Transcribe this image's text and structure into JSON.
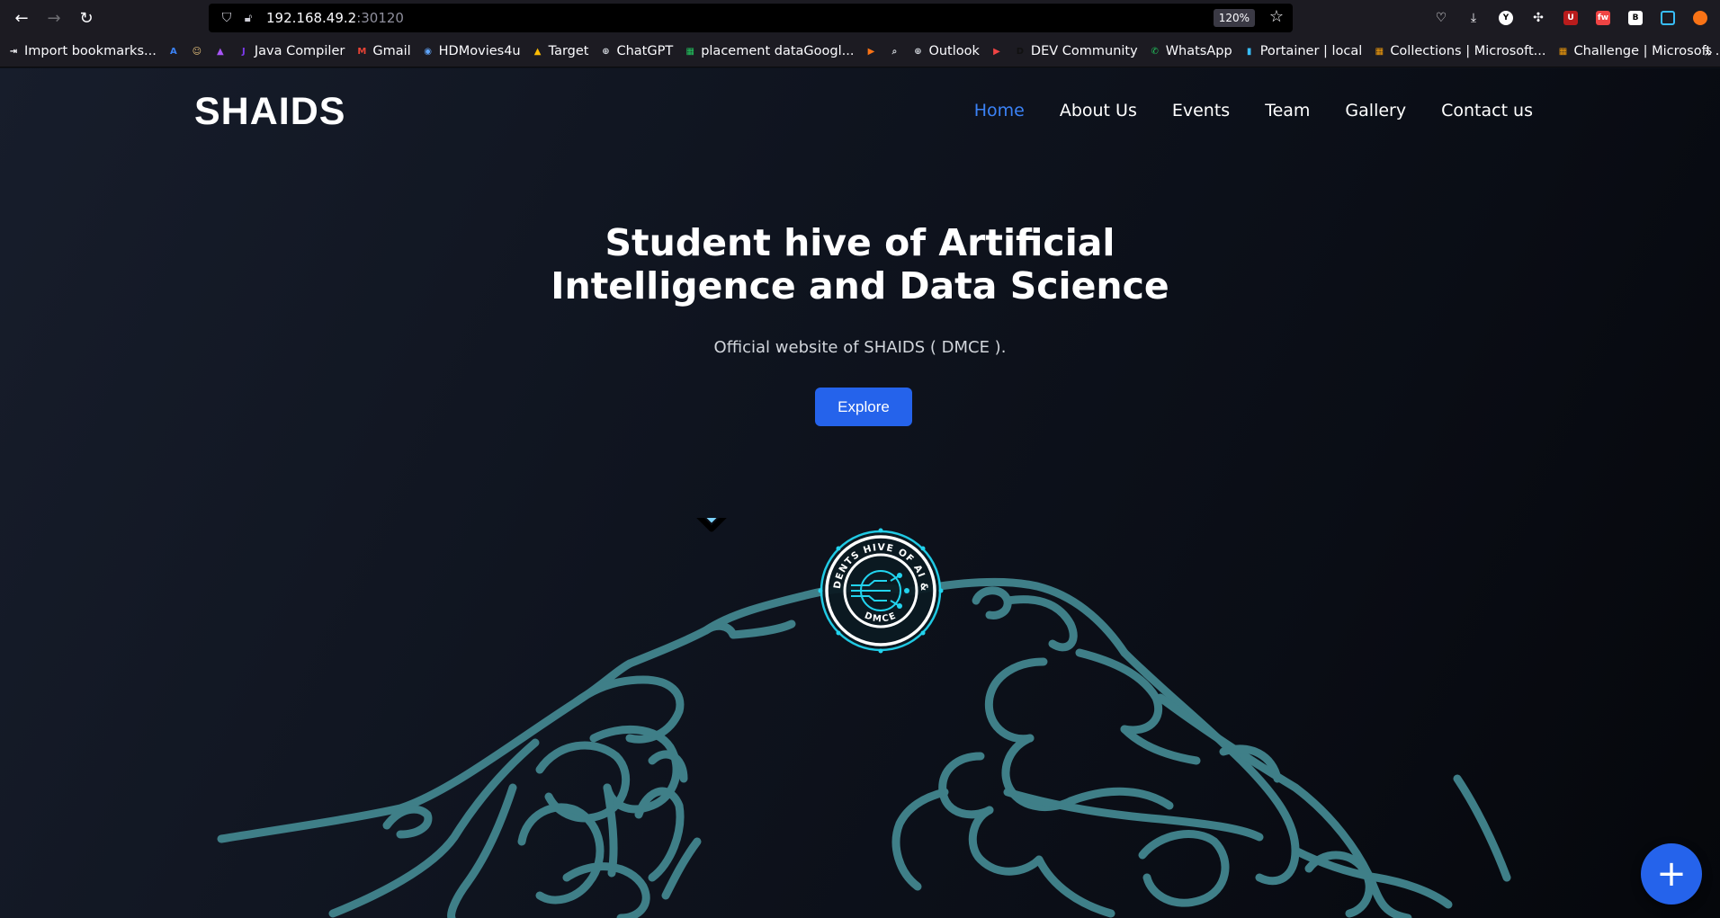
{
  "browser": {
    "url_host": "192.168.49.2",
    "url_port": ":30120",
    "zoom": "120%",
    "bookmarks": [
      {
        "label": "Import bookmarks...",
        "icon": "import-icon",
        "color": "#fbfbfe"
      },
      {
        "label": "",
        "icon": "azure-icon",
        "color": "#3b82f6"
      },
      {
        "label": "",
        "icon": "avatar-icon",
        "color": "#e5c07b"
      },
      {
        "label": "",
        "icon": "rocket-icon",
        "color": "#a855f7"
      },
      {
        "label": "Java Compiler",
        "icon": "java-icon",
        "color": "#7c3aed"
      },
      {
        "label": "Gmail",
        "icon": "gmail-icon",
        "color": "#ea4335"
      },
      {
        "label": "HDMovies4u",
        "icon": "hdmovies-icon",
        "color": "#60a5fa"
      },
      {
        "label": "Target",
        "icon": "drive-icon",
        "color": "#fbbc04"
      },
      {
        "label": "ChatGPT",
        "icon": "globe-icon",
        "color": "#d1d5db"
      },
      {
        "label": "placement dataGoogl...",
        "icon": "sheets-icon",
        "color": "#22c55e"
      },
      {
        "label": "",
        "icon": "play-icon",
        "color": "#f97316"
      },
      {
        "label": "",
        "icon": "search-doc-icon",
        "color": "#d1d5db"
      },
      {
        "label": "Outlook",
        "icon": "globe-icon",
        "color": "#d1d5db"
      },
      {
        "label": "",
        "icon": "youtube-icon",
        "color": "#ef4444"
      },
      {
        "label": "DEV Community",
        "icon": "dev-icon",
        "color": "#111111"
      },
      {
        "label": "WhatsApp",
        "icon": "whatsapp-icon",
        "color": "#22c55e"
      },
      {
        "label": "Portainer | local",
        "icon": "portainer-icon",
        "color": "#38bdf8"
      },
      {
        "label": "Collections | Microsoft...",
        "icon": "microsoft-icon",
        "color": "#f59e0b"
      },
      {
        "label": "Challenge | Microsoft ...",
        "icon": "microsoft-icon",
        "color": "#f59e0b"
      }
    ]
  },
  "site": {
    "brand": "SHAIDS",
    "nav": [
      "Home",
      "About Us",
      "Events",
      "Team",
      "Gallery",
      "Contact us"
    ],
    "hero_line1": "Student hive of Artificial",
    "hero_line2": "Intelligence and Data Science",
    "subtitle": "Official website of SHAIDS ( DMCE ).",
    "explore": "Explore",
    "badge_top_text": "STUDENTS HIVE OF AI & DS",
    "badge_bottom_text": "DMCE",
    "line_color": "#3f7f88",
    "accent": "#2563eb",
    "fab_symbol": "+"
  }
}
